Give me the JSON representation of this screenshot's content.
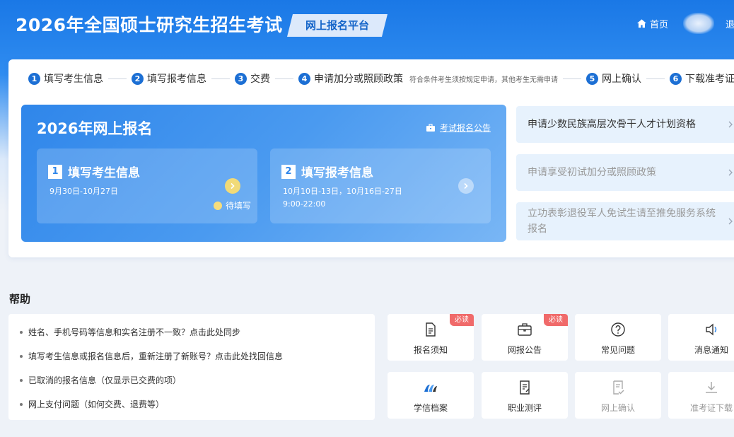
{
  "header": {
    "title": "2026年全国硕士研究生招生考试",
    "platform": "网上报名平台",
    "home": "首页",
    "logout": "退"
  },
  "steps": [
    {
      "num": "1",
      "label": "填写考生信息",
      "note": ""
    },
    {
      "num": "2",
      "label": "填写报考信息",
      "note": ""
    },
    {
      "num": "3",
      "label": "交费",
      "note": ""
    },
    {
      "num": "4",
      "label": "申请加分或照顾政策",
      "note": "符合条件考生须按规定申请，其他考生无需申请"
    },
    {
      "num": "5",
      "label": "网上确认",
      "note": ""
    },
    {
      "num": "6",
      "label": "下载准考证",
      "note": ""
    }
  ],
  "registration": {
    "title": "2026年网上报名",
    "announcement": "考试报名公告",
    "cards": [
      {
        "num": "1",
        "title": "填写考生信息",
        "dates": "9月30日-10月27日",
        "time": "",
        "status": "待填写"
      },
      {
        "num": "2",
        "title": "填写报考信息",
        "dates": "10月10日-13日，10月16日-27日",
        "time": "9:00-22:00",
        "status": ""
      }
    ]
  },
  "policies": [
    {
      "label": "申请少数民族高层次骨干人才计划资格"
    },
    {
      "label": "申请享受初试加分或照顾政策"
    },
    {
      "label": "立功表彰退役军人免试生请至推免服务系统报名"
    }
  ],
  "help": {
    "title": "帮助",
    "items": [
      "姓名、手机号码等信息和实名注册不一致？点击此处同步",
      "填写考生信息或报名信息后，重新注册了新账号？点击此处找回信息",
      "已取消的报名信息（仅显示已交费的项）",
      "网上支付问题（如何交费、退费等）"
    ]
  },
  "tiles": [
    {
      "label": "报名须知",
      "badge": "必读",
      "icon": "document-icon"
    },
    {
      "label": "网报公告",
      "badge": "必读",
      "icon": "briefcase-icon"
    },
    {
      "label": "常见问题",
      "badge": "",
      "icon": "question-icon"
    },
    {
      "label": "消息通知",
      "badge": "",
      "icon": "speaker-icon"
    },
    {
      "label": "学信档案",
      "badge": "",
      "icon": "chsi-logo-icon"
    },
    {
      "label": "职业测评",
      "badge": "",
      "icon": "assessment-icon"
    },
    {
      "label": "网上确认",
      "badge": "",
      "icon": "confirm-icon"
    },
    {
      "label": "准考证下载",
      "badge": "",
      "icon": "download-icon"
    }
  ],
  "colors": {
    "primary": "#1c6fd4",
    "accent_yellow": "#f1da78",
    "badge_red": "#f06a6a"
  }
}
